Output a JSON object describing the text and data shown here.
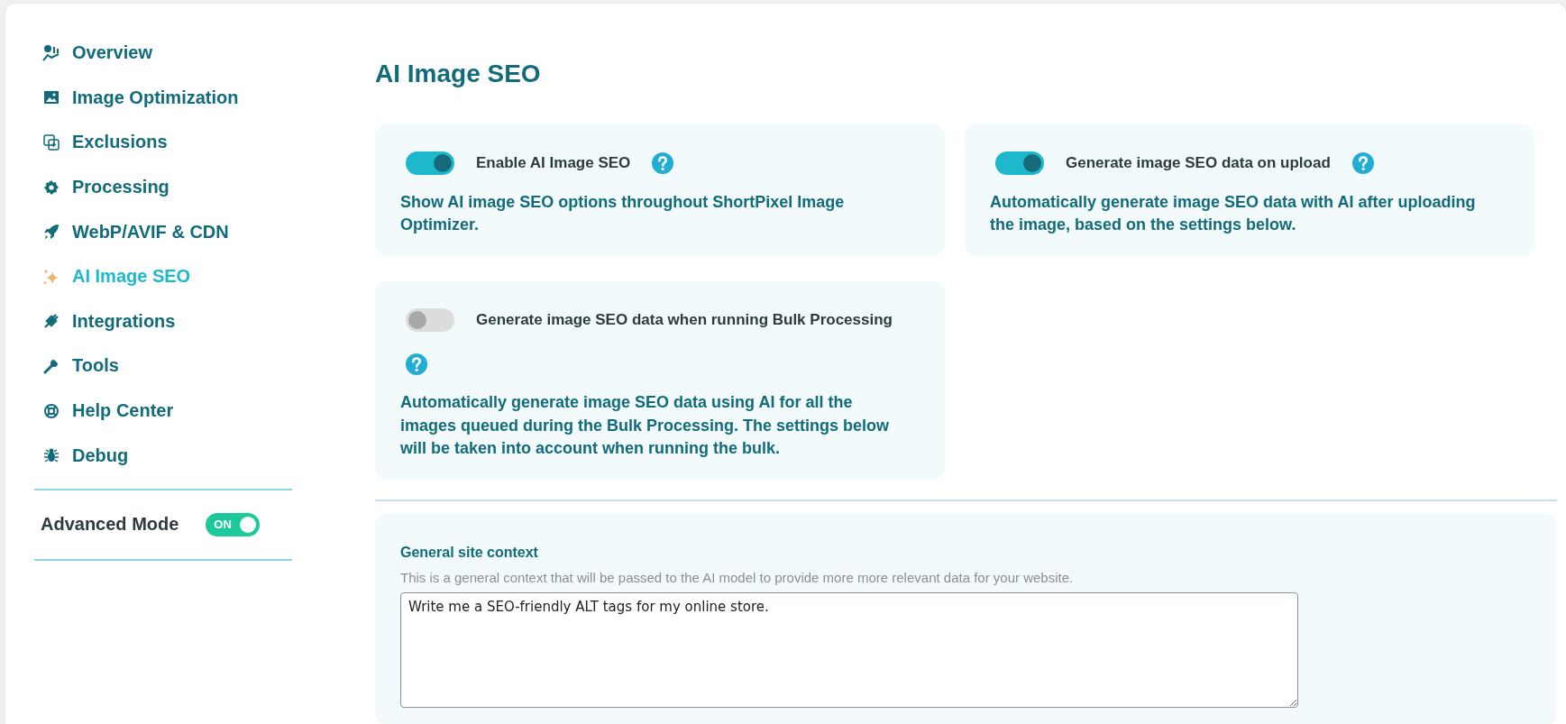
{
  "sidebar": {
    "items": [
      {
        "label": "Overview",
        "selected": false
      },
      {
        "label": "Image Optimization",
        "selected": false
      },
      {
        "label": "Exclusions",
        "selected": false
      },
      {
        "label": "Processing",
        "selected": false
      },
      {
        "label": "WebP/AVIF & CDN",
        "selected": false
      },
      {
        "label": "AI Image SEO",
        "selected": true
      },
      {
        "label": "Integrations",
        "selected": false
      },
      {
        "label": "Tools",
        "selected": false
      },
      {
        "label": "Help Center",
        "selected": false
      },
      {
        "label": "Debug",
        "selected": false
      }
    ],
    "advanced_mode": {
      "label": "Advanced Mode",
      "toggle_text": "ON",
      "on": true
    }
  },
  "page_title": "AI Image SEO",
  "settings": [
    {
      "label": "Enable AI Image SEO",
      "on": true,
      "description": "Show AI image SEO options throughout ShortPixel Image Optimizer."
    },
    {
      "label": "Generate image SEO data on upload",
      "on": true,
      "description": "Automatically generate image SEO data with AI after uploading the image, based on the settings below."
    },
    {
      "label": "Generate image SEO data when running Bulk Processing",
      "on": false,
      "description": "Automatically generate image SEO data using AI for all the images queued during the Bulk Processing. The settings below will be taken into account when running the bulk."
    }
  ],
  "context": {
    "title": "General site context",
    "hint": "This is a general context that will be passed to the AI model to provide more more relevant data for your website.",
    "value": "Write me a SEO-friendly ALT tags for my online store."
  }
}
